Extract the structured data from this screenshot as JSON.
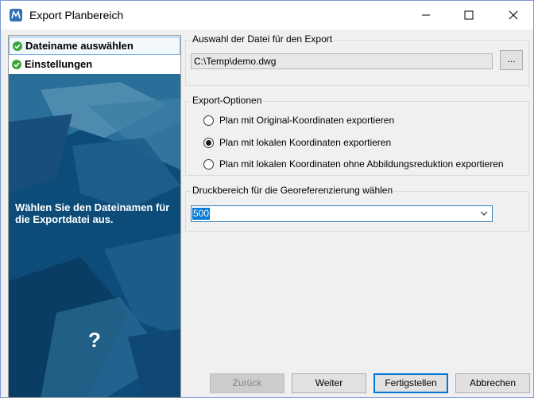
{
  "window": {
    "title": "Export Planbereich"
  },
  "icons": {
    "app": "app-logo-icon",
    "minimize": "minimize-icon",
    "maximize": "maximize-icon",
    "close": "close-icon",
    "check": "check-circle-icon",
    "help": "help-icon",
    "dropdown": "chevron-down-icon"
  },
  "steps": [
    {
      "label": "Dateiname auswählen",
      "active": true
    },
    {
      "label": "Einstellungen",
      "active": false
    }
  ],
  "panel": {
    "message": "Wählen Sie den Dateinamen für die Exportdatei aus.",
    "help_label": "?"
  },
  "file_group": {
    "title": "Auswahl der Datei für den Export",
    "path": "C:\\Temp\\demo.dwg",
    "browse_label": "..."
  },
  "export_options": {
    "title": "Export-Optionen",
    "options": [
      {
        "label": "Plan mit Original-Koordinaten exportieren",
        "selected": false
      },
      {
        "label": "Plan mit lokalen Koordinaten exportieren",
        "selected": true
      },
      {
        "label": "Plan mit lokalen Koordinaten ohne Abbildungsreduktion exportieren",
        "selected": false
      }
    ]
  },
  "print_area": {
    "title": "Druckbereich für die Georeferenzierung wählen",
    "value": "500"
  },
  "buttons": {
    "back": "Zurück",
    "next": "Weiter",
    "finish": "Fertigstellen",
    "cancel": "Abbrechen"
  },
  "colors": {
    "panel_bg": "#0d4c78",
    "check_green": "#3aa63a",
    "accent": "#0078d7"
  }
}
